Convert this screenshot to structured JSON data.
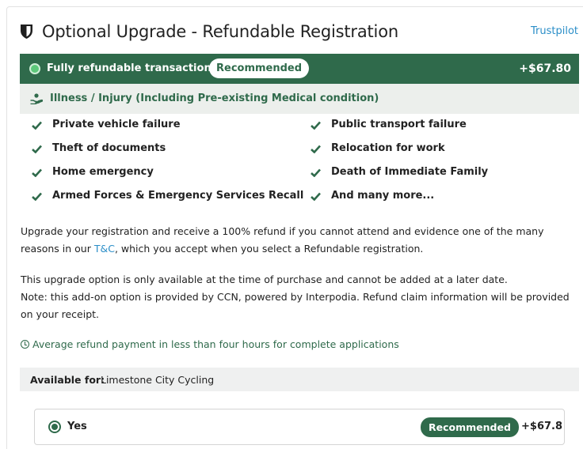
{
  "header": {
    "title": "Optional Upgrade - Refundable Registration",
    "trustpilot_link": "Trustpilot"
  },
  "refund_bar": {
    "label": "Fully refundable transaction",
    "badge": "Recommended",
    "price": "+$67.80",
    "accent_color": "#2f6a4b"
  },
  "coverage_header": "Illness / Injury (Including Pre-existing Medical condition)",
  "features": [
    "Private vehicle failure",
    "Public transport failure",
    "Theft of documents",
    "Relocation for work",
    "Home emergency",
    "Death of Immediate Family",
    "Armed Forces & Emergency Services Recall",
    "And many more..."
  ],
  "description": {
    "line1": "Upgrade your registration and receive a 100% refund if you cannot attend and evidence one of the many",
    "line2_prefix": "reasons in our ",
    "tc_link": "T&C",
    "line2_suffix": ", which you accept when you select a Refundable registration."
  },
  "notice": {
    "line1": "This upgrade option is only available at the time of purchase and cannot be added at a later date.",
    "line2": "Note: this add-on option is provided by CCN, powered by Interpodia. Refund claim information will be provided",
    "line3": "on your receipt."
  },
  "average_refund": "Average refund payment in less than four hours for complete applications",
  "available_for": {
    "label": "Available for:",
    "value": "Limestone City Cycling"
  },
  "option": {
    "label": "Yes",
    "badge": "Recommended",
    "price": "+$67.8",
    "selected": true
  }
}
